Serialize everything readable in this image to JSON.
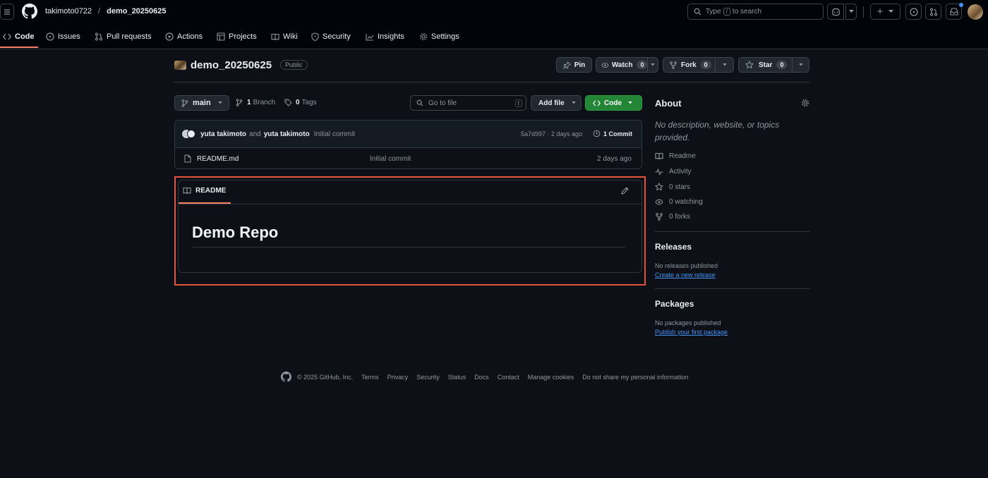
{
  "header": {
    "owner": "takimoto0722",
    "separator": "/",
    "repo": "demo_20250625",
    "search_prefix": "Type",
    "search_key": "/",
    "search_suffix": "to search",
    "plus": "+"
  },
  "repo_nav": [
    {
      "label": "Code",
      "icon": "code-icon"
    },
    {
      "label": "Issues",
      "icon": "issue-icon"
    },
    {
      "label": "Pull requests",
      "icon": "pull-request-icon"
    },
    {
      "label": "Actions",
      "icon": "play-icon"
    },
    {
      "label": "Projects",
      "icon": "table-icon"
    },
    {
      "label": "Wiki",
      "icon": "book-icon"
    },
    {
      "label": "Security",
      "icon": "shield-icon"
    },
    {
      "label": "Insights",
      "icon": "graph-icon"
    },
    {
      "label": "Settings",
      "icon": "gear-icon"
    }
  ],
  "repo_title": {
    "name": "demo_20250625",
    "visibility": "Public",
    "pin": "Pin",
    "watch": "Watch",
    "watch_count": "0",
    "fork": "Fork",
    "fork_count": "0",
    "star": "Star",
    "star_count": "0"
  },
  "toolbar": {
    "branch": "main",
    "branch_count": "1",
    "branch_label": "Branch",
    "tag_count": "0",
    "tag_label": "Tags",
    "goto_placeholder": "Go to file",
    "goto_key": "t",
    "add_file": "Add file",
    "code": "Code"
  },
  "commit": {
    "author1": "yuta takimoto",
    "and": "and",
    "author2": "yuta takimoto",
    "message": "Initial commit",
    "hash_time": "5a7d997 · 2 days ago",
    "commit_count": "1 Commit"
  },
  "files": [
    {
      "name": "README.md",
      "message": "Initial commit",
      "time": "2 days ago"
    }
  ],
  "readme": {
    "tab": "README",
    "heading": "Demo Repo"
  },
  "about": {
    "title": "About",
    "description": "No description, website, or topics provided.",
    "items": [
      {
        "icon": "book-icon",
        "label": "Readme"
      },
      {
        "icon": "pulse-icon",
        "label": "Activity"
      },
      {
        "icon": "star-icon",
        "label": "0 stars"
      },
      {
        "icon": "eye-icon",
        "label": "0 watching"
      },
      {
        "icon": "fork-icon",
        "label": "0 forks"
      }
    ]
  },
  "releases": {
    "title": "Releases",
    "empty": "No releases published",
    "link": "Create a new release"
  },
  "packages": {
    "title": "Packages",
    "empty": "No packages published",
    "link": "Publish your first package"
  },
  "footer": {
    "copyright": "© 2025 GitHub, Inc.",
    "links": [
      "Terms",
      "Privacy",
      "Security",
      "Status",
      "Docs",
      "Contact",
      "Manage cookies",
      "Do not share my personal information"
    ]
  },
  "colors": {
    "bg": "#0d1117",
    "header_bg": "#010409",
    "accent": "#f78166",
    "green": "#238636",
    "link": "#4493f8",
    "highlight": "#e5533d"
  }
}
